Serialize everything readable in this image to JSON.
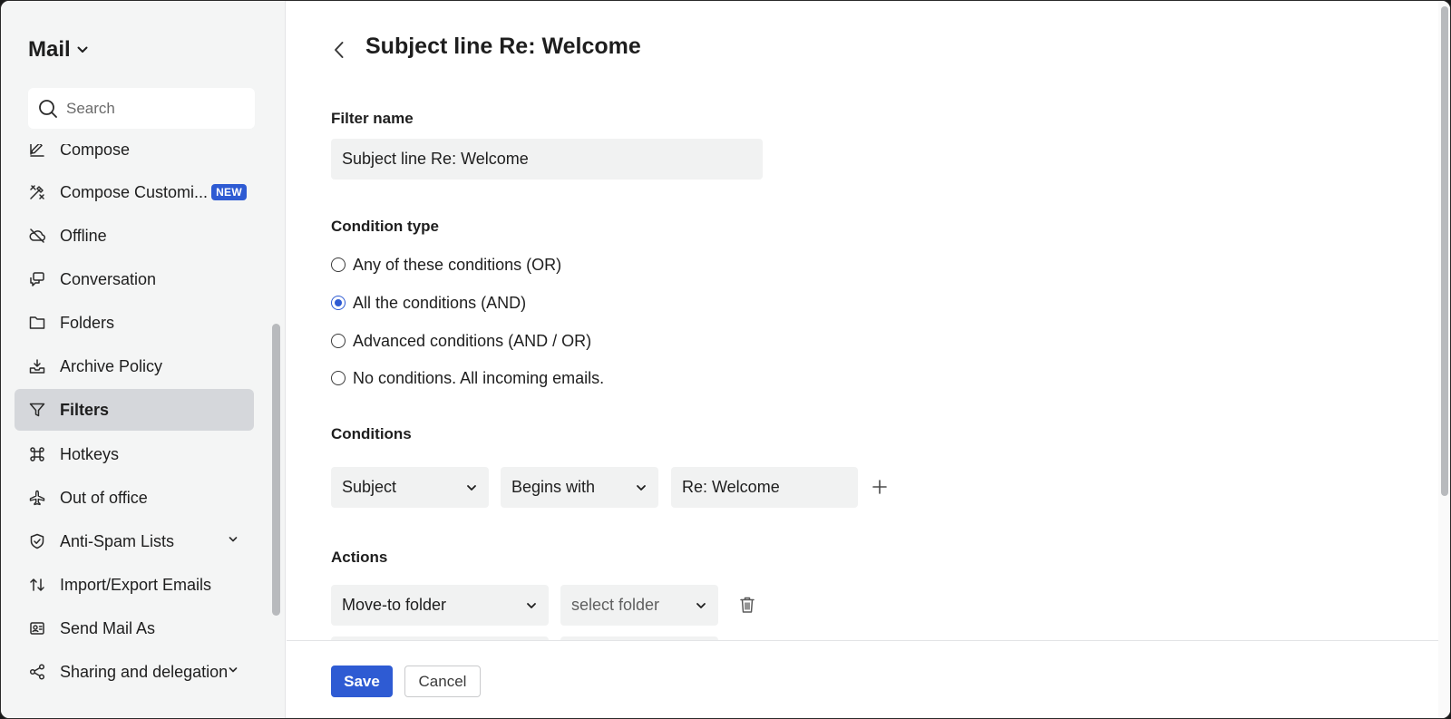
{
  "sidebar": {
    "app_title": "Mail",
    "search_placeholder": "Search",
    "items": [
      {
        "label": "Compose",
        "icon": "compose-icon"
      },
      {
        "label": "Compose Customi...",
        "icon": "customize-icon",
        "badge": "NEW"
      },
      {
        "label": "Offline",
        "icon": "cloud-off-icon"
      },
      {
        "label": "Conversation",
        "icon": "conversation-icon"
      },
      {
        "label": "Folders",
        "icon": "folder-icon"
      },
      {
        "label": "Archive Policy",
        "icon": "archive-icon"
      },
      {
        "label": "Filters",
        "icon": "filter-icon",
        "active": true
      },
      {
        "label": "Hotkeys",
        "icon": "command-icon"
      },
      {
        "label": "Out of office",
        "icon": "plane-icon"
      },
      {
        "label": "Anti-Spam Lists",
        "icon": "shield-icon",
        "expandable": true
      },
      {
        "label": "Import/Export Emails",
        "icon": "import-export-icon"
      },
      {
        "label": "Send Mail As",
        "icon": "send-as-icon"
      },
      {
        "label": "Sharing and delegation",
        "icon": "share-icon",
        "expandable": true
      }
    ]
  },
  "main": {
    "title": "Subject line Re: Welcome",
    "filter_name_label": "Filter name",
    "filter_name_value": "Subject line Re: Welcome",
    "condition_type_label": "Condition type",
    "condition_options": [
      {
        "label": "Any of these conditions (OR)",
        "checked": false
      },
      {
        "label": "All the conditions (AND)",
        "checked": true
      },
      {
        "label": "Advanced conditions (AND / OR)",
        "checked": false
      },
      {
        "label": "No conditions. All incoming emails.",
        "checked": false
      }
    ],
    "conditions_label": "Conditions",
    "condition": {
      "field": "Subject",
      "operator": "Begins with",
      "value": "Re: Welcome"
    },
    "actions_label": "Actions",
    "action": {
      "type": "Move-to folder",
      "folder_placeholder": "select folder"
    },
    "save_label": "Save",
    "cancel_label": "Cancel"
  },
  "colors": {
    "accent": "#2e5bd3",
    "sidebar_bg": "#f4f5f5",
    "active_item_bg": "#d5d7db",
    "field_bg": "#f1f2f2"
  }
}
